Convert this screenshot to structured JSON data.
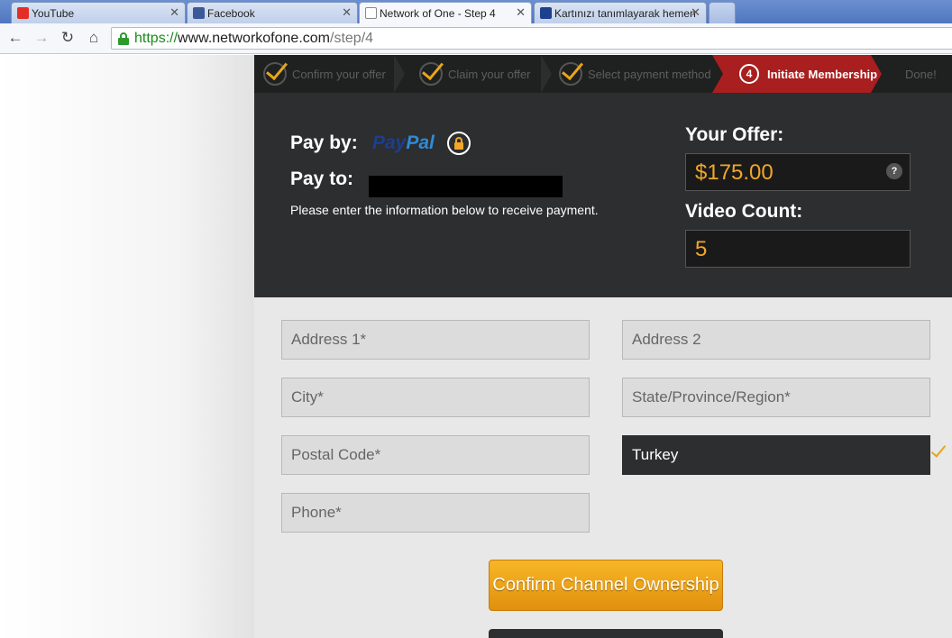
{
  "browser": {
    "tabs": [
      {
        "title": "YouTube",
        "icon": "youtube-icon",
        "active": false
      },
      {
        "title": "Facebook",
        "icon": "facebook-icon",
        "active": false
      },
      {
        "title": "Network of One - Step 4",
        "icon": "page-icon",
        "active": true
      },
      {
        "title": "Kartınızı tanımlayarak hemen",
        "icon": "paypal-icon",
        "active": false
      }
    ],
    "close_glyph": "✕",
    "url": {
      "scheme": "https://",
      "host": "www.networkofone.com",
      "path": "/step/4"
    }
  },
  "steps": [
    {
      "label": "Confirm your offer",
      "done": true
    },
    {
      "label": "Claim your offer",
      "done": true
    },
    {
      "label": "Select payment method",
      "done": true
    },
    {
      "label": "Initiate Membership",
      "number": "4",
      "active": true
    },
    {
      "label": "Done!",
      "done": false
    }
  ],
  "payment": {
    "pay_by_label": "Pay by:",
    "paypal_pay": "Pay",
    "paypal_pal": "Pal",
    "pay_to_label": "Pay to:",
    "note": "Please enter the information below to receive payment.",
    "offer_label": "Your Offer:",
    "offer_value": "$175.00",
    "help_glyph": "?",
    "video_count_label": "Video Count:",
    "video_count_value": "5"
  },
  "form": {
    "address1_placeholder": "Address 1*",
    "address2_placeholder": "Address 2",
    "city_placeholder": "City*",
    "state_placeholder": "State/Province/Region*",
    "postal_placeholder": "Postal Code*",
    "country_value": "Turkey",
    "phone_placeholder": "Phone*",
    "confirm_button": "Confirm Channel Ownership"
  },
  "colors": {
    "accent": "#e8a51e",
    "active_step": "#a91e1e",
    "panel": "#2d2e2f"
  }
}
